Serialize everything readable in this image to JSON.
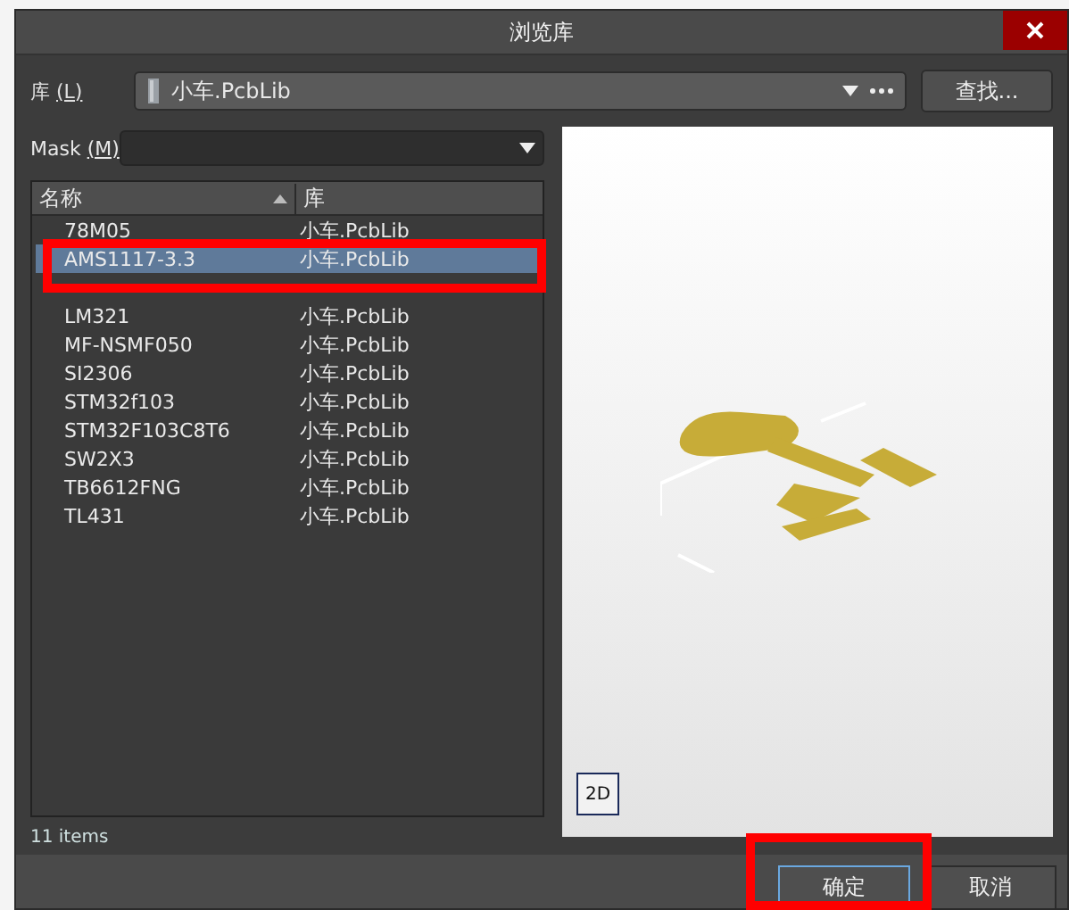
{
  "window": {
    "title": "浏览库"
  },
  "library": {
    "label": "库",
    "hotkey": "(L)",
    "value": "小车.PcbLib",
    "search_button": "查找..."
  },
  "mask": {
    "label": "Mask",
    "hotkey": "(M)"
  },
  "table": {
    "columns": [
      "名称",
      "库"
    ],
    "rows": [
      {
        "name": "78M05",
        "library": "小车.PcbLib",
        "selected": false
      },
      {
        "name": "AMS1117-3.3",
        "library": "小车.PcbLib",
        "selected": true
      },
      {
        "selected": false
      },
      {
        "name": "LM321",
        "library": "小车.PcbLib",
        "selected": false
      },
      {
        "name": "MF-NSMF050",
        "library": "小车.PcbLib",
        "selected": false
      },
      {
        "name": "SI2306",
        "library": "小车.PcbLib",
        "selected": false
      },
      {
        "name": "STM32f103",
        "library": "小车.PcbLib",
        "selected": false
      },
      {
        "name": "STM32F103C8T6",
        "library": "小车.PcbLib",
        "selected": false
      },
      {
        "name": "SW2X3",
        "library": "小车.PcbLib",
        "selected": false
      },
      {
        "name": "TB6612FNG",
        "library": "小车.PcbLib",
        "selected": false
      },
      {
        "name": "TL431",
        "library": "小车.PcbLib",
        "selected": false
      }
    ]
  },
  "item_count": "11 items",
  "preview": {
    "view_button": "2D"
  },
  "buttons": [
    {
      "label": "确定",
      "focused": true
    },
    {
      "label": "取消",
      "focused": false
    }
  ]
}
